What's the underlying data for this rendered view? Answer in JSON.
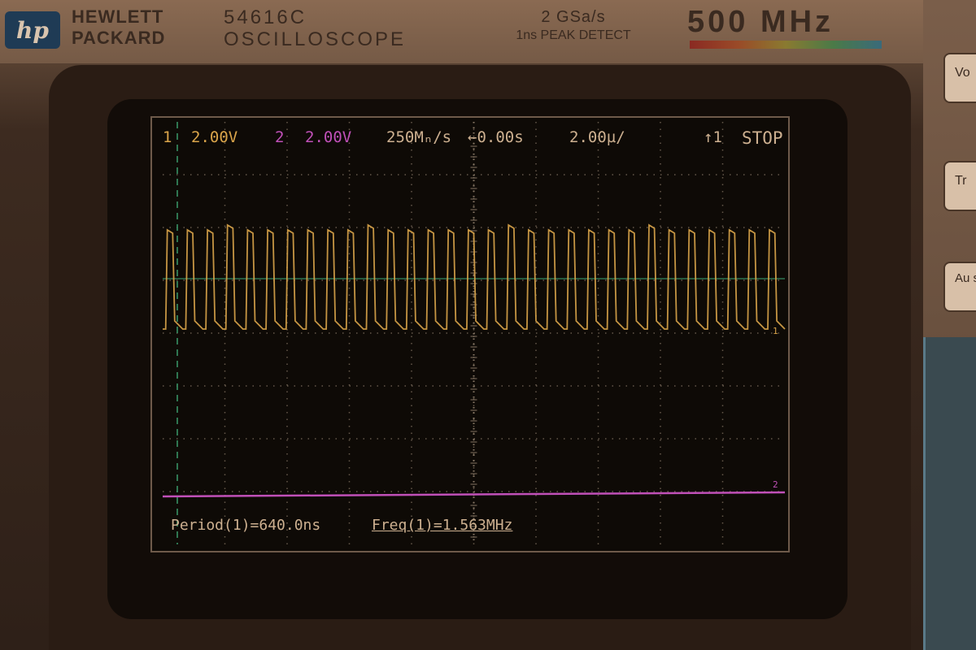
{
  "header": {
    "logo_text": "hp",
    "brand_line1": "HEWLETT",
    "brand_line2": "PACKARD",
    "model_line1": "54616C",
    "model_line2": "OSCILLOSCOPE",
    "rate_line1": "2 GSa/s",
    "rate_line2": "1ns PEAK DETECT",
    "bandwidth": "500 MHz"
  },
  "status_bar": {
    "ch1_label": "1",
    "ch1_scale": "2.00V",
    "ch2_label": "2",
    "ch2_scale": "2.00V",
    "sample_rate": "250Mₙ/s",
    "time_offset": "←0.00s",
    "time_scale": "2.00µ/",
    "trigger": "↑1",
    "run_state": "STOP"
  },
  "measurements": {
    "period": "Period(1)=640.0ns",
    "freq": "Freq(1)=1.563MHz"
  },
  "side_buttons": {
    "btn1": "Vo",
    "btn2": "Tr",
    "btn3": "Au sc"
  },
  "colors": {
    "ch1": "#d9a44a",
    "ch2": "#c050b8",
    "grid": "#8a7a68",
    "marker": "#3a9a6a"
  },
  "chart_data": {
    "type": "line",
    "series": [
      {
        "name": "1",
        "description_of_signal": "square wave",
        "period_ns": 640.0,
        "frequency_mhz": 1.563,
        "cycles_visible": 31
      },
      {
        "name": "2",
        "level": "flat"
      }
    ],
    "x_scale": "2.00µ/",
    "y_scale_ch1": "2.00V",
    "y_scale_ch2": "2.00V"
  }
}
